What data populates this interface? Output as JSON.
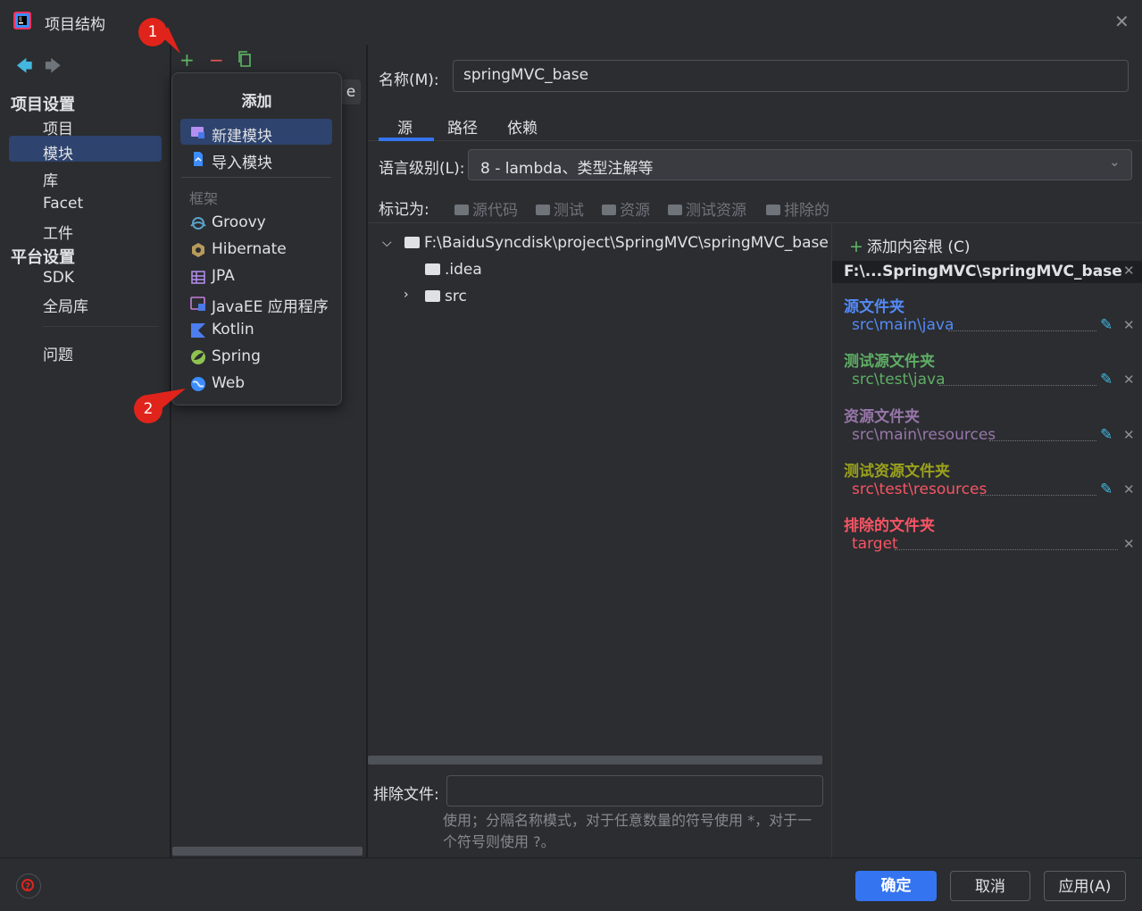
{
  "window": {
    "title": "项目结构"
  },
  "left_nav": {
    "project_settings_header": "项目设置",
    "project_settings_items": [
      "项目",
      "模块",
      "库",
      "Facet",
      "工件"
    ],
    "platform_settings_header": "平台设置",
    "platform_settings_items": [
      "SDK",
      "全局库"
    ],
    "problems": "问题",
    "selected": "模块"
  },
  "middle": {
    "tab_partial": "e"
  },
  "popup": {
    "title": "添加",
    "items": [
      "新建模块",
      "导入模块"
    ],
    "group_label": "框架",
    "frameworks": [
      "Groovy",
      "Hibernate",
      "JPA",
      "JavaEE 应用程序",
      "Kotlin",
      "Spring",
      "Web"
    ]
  },
  "badges": [
    "1",
    "2"
  ],
  "module": {
    "name_label": "名称(M):",
    "name_value": "springMVC_base",
    "tabs": [
      "源",
      "路径",
      "依赖"
    ],
    "active_tab": "源",
    "language_label": "语言级别(L):",
    "language_value": "8 - lambda、类型注解等",
    "mark_as_label": "标记为:",
    "mark_as": [
      "源代码",
      "测试",
      "资源",
      "测试资源",
      "排除的"
    ]
  },
  "tree": {
    "root": "F:\\BaiduSyncdisk\\project\\SpringMVC\\springMVC_base",
    "children": [
      ".idea",
      "src"
    ]
  },
  "exclude": {
    "label": "排除文件:",
    "value": "",
    "hint": "使用；分隔名称模式，对于任意数量的符号使用 *，对于一个符号则使用 ?。"
  },
  "content_root": {
    "add_label": "添加内容根 (C)",
    "root_path": "F:\\...SpringMVC\\springMVC_base",
    "groups": [
      {
        "title": "源文件夹",
        "path": "src\\main\\java",
        "color": "#548af7"
      },
      {
        "title": "测试源文件夹",
        "path": "src\\test\\java",
        "color": "#5fad65"
      },
      {
        "title": "资源文件夹",
        "path": "src\\main\\resources",
        "color": "#9876aa"
      },
      {
        "title": "测试资源文件夹",
        "path": "src\\test\\resources",
        "color": "#9aa11c"
      },
      {
        "title": "排除的文件夹",
        "path": "target",
        "color": "#f75464"
      }
    ]
  },
  "footer": {
    "ok": "确定",
    "cancel": "取消",
    "apply": "应用(A)"
  },
  "colors": {
    "accent": "#3574f0",
    "selection": "#2e436e",
    "badge": "#e0241b"
  }
}
